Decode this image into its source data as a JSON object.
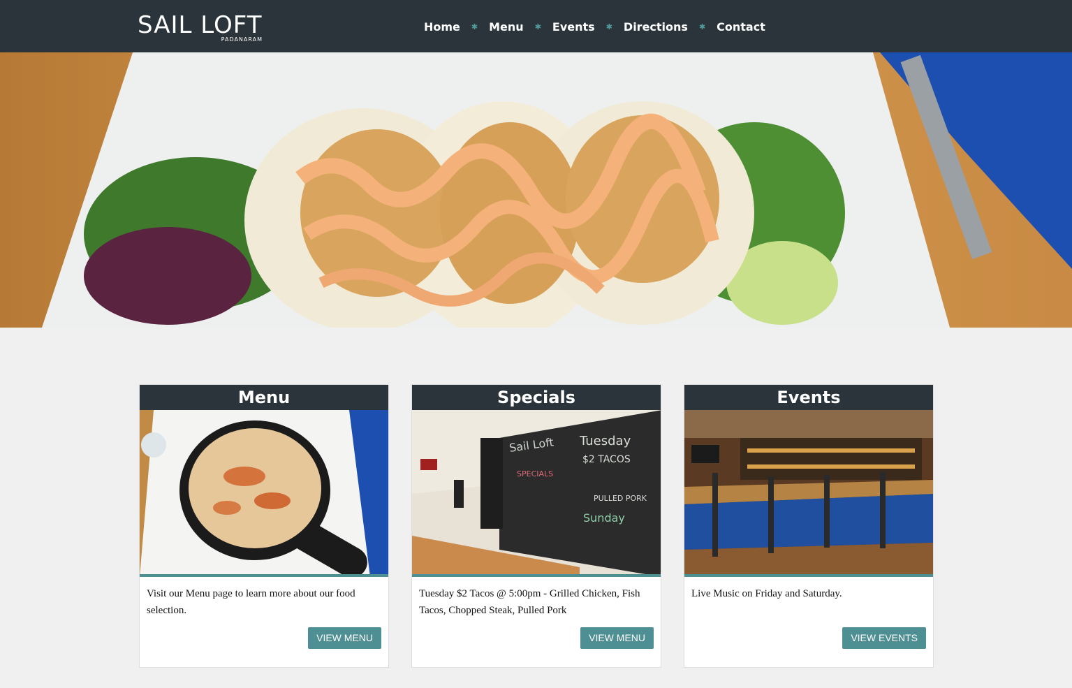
{
  "header": {
    "logo_text": "SAIL LOFT",
    "logo_sub": "PADANARAM",
    "nav": [
      "Home",
      "Menu",
      "Events",
      "Directions",
      "Contact"
    ],
    "nav_separator": "✱",
    "colors": {
      "bar": "#2b343a",
      "accent": "#4e9a9c"
    }
  },
  "hero": {
    "icon": "tacos-photo"
  },
  "cards": [
    {
      "title": "Menu",
      "image": "mac-and-cheese-skillet-photo",
      "text": "Visit our Menu page to learn more about our food selection.",
      "button": "VIEW MENU"
    },
    {
      "title": "Specials",
      "image": "specials-chalkboard-photo",
      "text": "Tuesday $2 Tacos @ 5:00pm - Grilled Chicken, Fish Tacos, Chopped Steak, Pulled Pork",
      "button": "VIEW MENU"
    },
    {
      "title": "Events",
      "image": "bar-interior-photo",
      "text": "Live Music on Friday and Saturday.",
      "button": "VIEW EVENTS"
    }
  ],
  "colors": {
    "button": "#4e8f94",
    "page_bg": "#f0f0f0"
  }
}
